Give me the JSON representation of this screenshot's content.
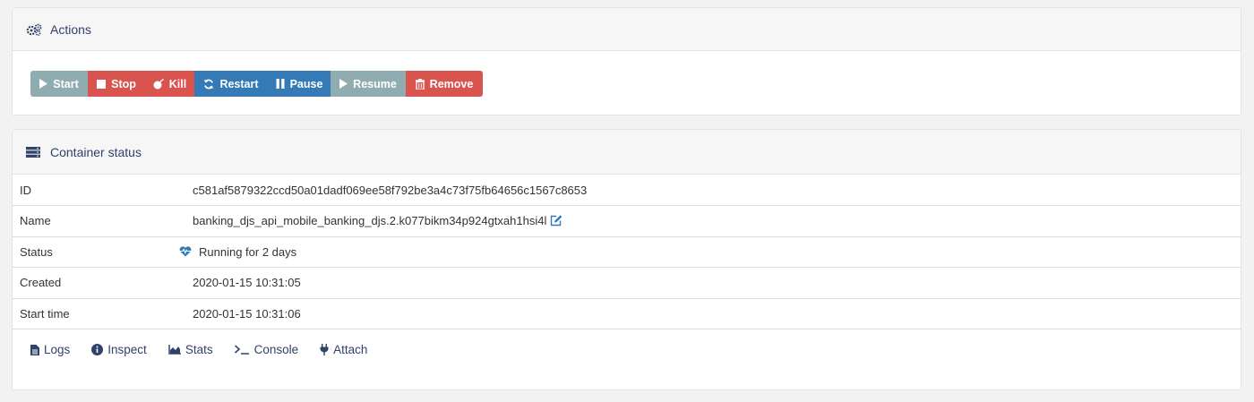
{
  "actions": {
    "title": "Actions",
    "buttons": {
      "start": {
        "label": "Start",
        "color": "#8fadb0"
      },
      "stop": {
        "label": "Stop",
        "color": "#d9534f"
      },
      "kill": {
        "label": "Kill",
        "color": "#d9534f"
      },
      "restart": {
        "label": "Restart",
        "color": "#337ab7"
      },
      "pause": {
        "label": "Pause",
        "color": "#337ab7"
      },
      "resume": {
        "label": "Resume",
        "color": "#8fadb0"
      },
      "remove": {
        "label": "Remove",
        "color": "#d9534f"
      }
    }
  },
  "container_status": {
    "title": "Container status",
    "rows": {
      "id": {
        "key": "ID",
        "value": "c581af5879322ccd50a01dadf069ee58f792be3a4c73f75fb64656c1567c8653"
      },
      "name": {
        "key": "Name",
        "value": "banking_djs_api_mobile_banking_djs.2.k077bikm34p924gtxah1hsi4l"
      },
      "status": {
        "key": "Status",
        "value": "Running for 2 days"
      },
      "created": {
        "key": "Created",
        "value": "2020-01-15 10:31:05"
      },
      "start_time": {
        "key": "Start time",
        "value": "2020-01-15 10:31:06"
      }
    },
    "links": {
      "logs": "Logs",
      "inspect": "Inspect",
      "stats": "Stats",
      "console": "Console",
      "attach": "Attach"
    }
  },
  "colors": {
    "heading_text": "#30426a",
    "link": "#30426a",
    "running_heart": "#337ab7",
    "edit_icon": "#337ab7"
  }
}
